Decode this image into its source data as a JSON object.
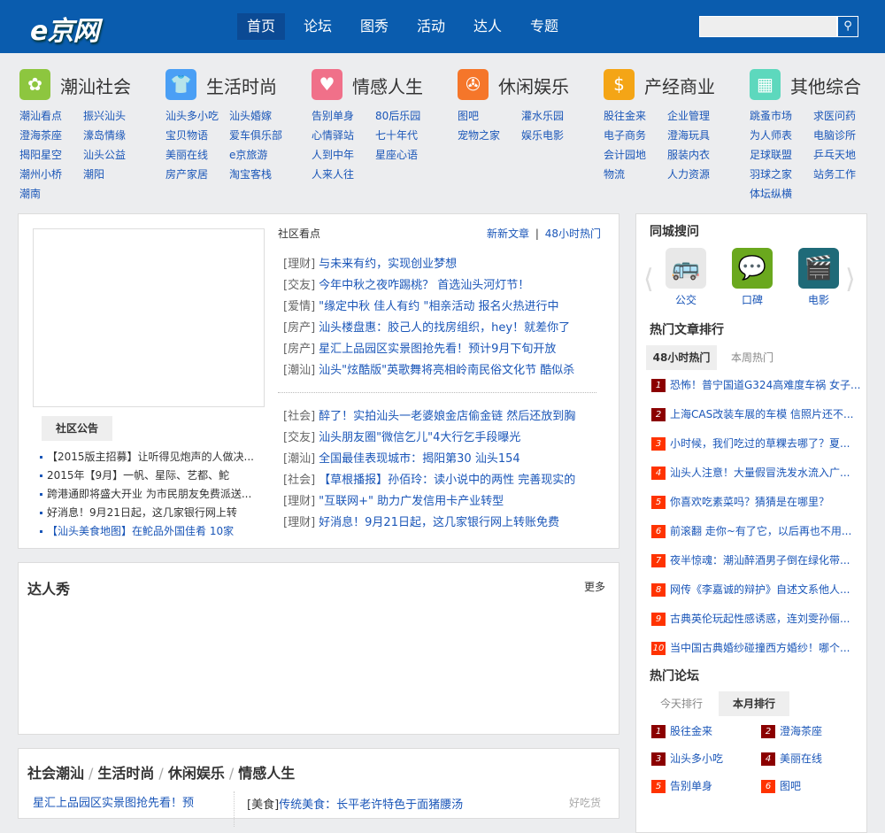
{
  "header": {
    "logo": "e京网",
    "nav": [
      "首页",
      "论坛",
      "图秀",
      "活动",
      "达人",
      "专题"
    ],
    "search_placeholder": "",
    "search_icon": "search-icon"
  },
  "categories": [
    {
      "title": "潮汕社会",
      "color": "#8dc63f",
      "icon": "globe-hands-icon",
      "links": [
        "潮汕看点",
        "振兴汕头",
        "澄海茶座",
        "濠岛情缘",
        "揭阳星空",
        "汕头公益",
        "潮州小桥",
        "潮阳",
        "潮南"
      ]
    },
    {
      "title": "生活时尚",
      "color": "#4a9ff5",
      "icon": "tshirt-icon",
      "links": [
        "汕头多小吃",
        "汕头婚嫁",
        "宝贝物语",
        "爱车俱乐部",
        "美丽在线",
        "e京旅游",
        "房产家居",
        "淘宝客栈"
      ]
    },
    {
      "title": "情感人生",
      "color": "#f07089",
      "icon": "heart-icon",
      "links": [
        "告别单身",
        "80后乐园",
        "心情驿站",
        "七十年代",
        "人到中年",
        "星座心语",
        "人来人往"
      ]
    },
    {
      "title": "休闲娱乐",
      "color": "#f5762a",
      "icon": "film-reel-icon",
      "links": [
        "图吧",
        "灌水乐园",
        "宠物之家",
        "娱乐电影"
      ]
    },
    {
      "title": "产经商业",
      "color": "#f4a516",
      "icon": "coins-icon",
      "links": [
        "股往金来",
        "企业管理",
        "电子商务",
        "澄海玩具",
        "会计园地",
        "服装内衣",
        "物流",
        "人力资源"
      ]
    },
    {
      "title": "其他综合",
      "color": "#5dd8bd",
      "icon": "grid-icon",
      "links": [
        "跳蚤市场",
        "求医问药",
        "为人师表",
        "电脑诊所",
        "足球联盟",
        "乒乓天地",
        "羽球之家",
        "站务工作",
        "体坛纵横"
      ]
    }
  ],
  "community": {
    "notice_tab": "社区公告",
    "notices": [
      "【2015版主招募】让听得见炮声的人做决...",
      "2015年【9月】一帆、星际、艺都、鮀",
      "跨港通即将盛大开业 为市民朋友免费派送...",
      "好消息！9月21日起，这几家银行网上转",
      "【汕头美食地图】在鮀品外国佳肴 10家"
    ],
    "title": "社区看点",
    "link_new": "新新文章",
    "sep": "|",
    "link_hot": "48小时热门",
    "news1": [
      [
        "[理财]",
        "与未来有约，实现创业梦想"
      ],
      [
        "[交友]",
        "今年中秋之夜咋踢桃？ 首选汕头河灯节！"
      ],
      [
        "[爱情]",
        "\"缘定中秋 佳人有约 \"相亲活动 报名火热进行中"
      ],
      [
        "[房产]",
        "汕头楼盘惠：胶己人的找房组织，hey！就差你了"
      ],
      [
        "[房产]",
        "星汇上品园区实景图抢先看！预计9月下旬开放"
      ],
      [
        "[潮汕]",
        "汕头\"炫酷版\"英歌舞将亮相岭南民俗文化节 酷似杀"
      ]
    ],
    "news2": [
      [
        "[社会]",
        "醉了！实拍汕头一老婆娘金店偷金链 然后还放到胸"
      ],
      [
        "[交友]",
        "汕头朋友圈\"微信乞儿\"4大行乞手段曝光"
      ],
      [
        "[潮汕]",
        "全国最佳表现城市：揭阳第30 汕头154"
      ],
      [
        "[社会]",
        "【草根播报】孙佰玲：读小说中的两性 完善现实的"
      ],
      [
        "[理财]",
        "\"互联网+\" 助力广发信用卡产业转型"
      ],
      [
        "[理财]",
        "好消息！9月21日起，这几家银行网上转账免费"
      ]
    ]
  },
  "talent": {
    "title": "达人秀",
    "more": "更多"
  },
  "bottom": {
    "tabs": [
      "社会潮汕",
      "生活时尚",
      "休闲娱乐",
      "情感人生"
    ],
    "sep": "/",
    "left_link": "星汇上品园区实景图抢先看！预",
    "tag": "[美食]",
    "right_link": "传统美食：长平老许特色于面猪腰汤",
    "right_note": "好吃货"
  },
  "sidebar": {
    "qa_title": "同城搜问",
    "qa": [
      {
        "label": "公交",
        "icon": "bus-map-icon"
      },
      {
        "label": "口碑",
        "icon": "speech-bubble-icon"
      },
      {
        "label": "电影",
        "icon": "clapperboard-icon"
      }
    ],
    "hot_title": "热门文章排行",
    "hot_tabs": [
      "48小时热门",
      "本周热门"
    ],
    "hot": [
      "恐怖！普宁国道G324高难度车祸 女子...",
      "上海CAS改装车展的车模 信照片还不...",
      "小时候，我们吃过的草粿去哪了？夏...",
      "汕头人注意！大量假冒洗发水流入广...",
      "你喜欢吃素菜吗？猜猜是在哪里？",
      "前滚翻 走你~有了它，以后再也不用...",
      "夜半惊魂：潮汕醉酒男子倒在绿化带...",
      "网传《李嘉诚的辩护》自述文系他人...",
      "古典英伦玩起性感诱惑，连刘雯孙俪...",
      "当中国古典婚纱碰撞西方婚纱！哪个..."
    ],
    "forum_title": "热门论坛",
    "forum_tabs": [
      "今天排行",
      "本月排行"
    ],
    "forum": [
      "股往金来",
      "澄海茶座",
      "汕头多小吃",
      "美丽在线",
      "告别单身",
      "图吧"
    ],
    "dark": "#8b0000",
    "red": "#ff3300"
  }
}
